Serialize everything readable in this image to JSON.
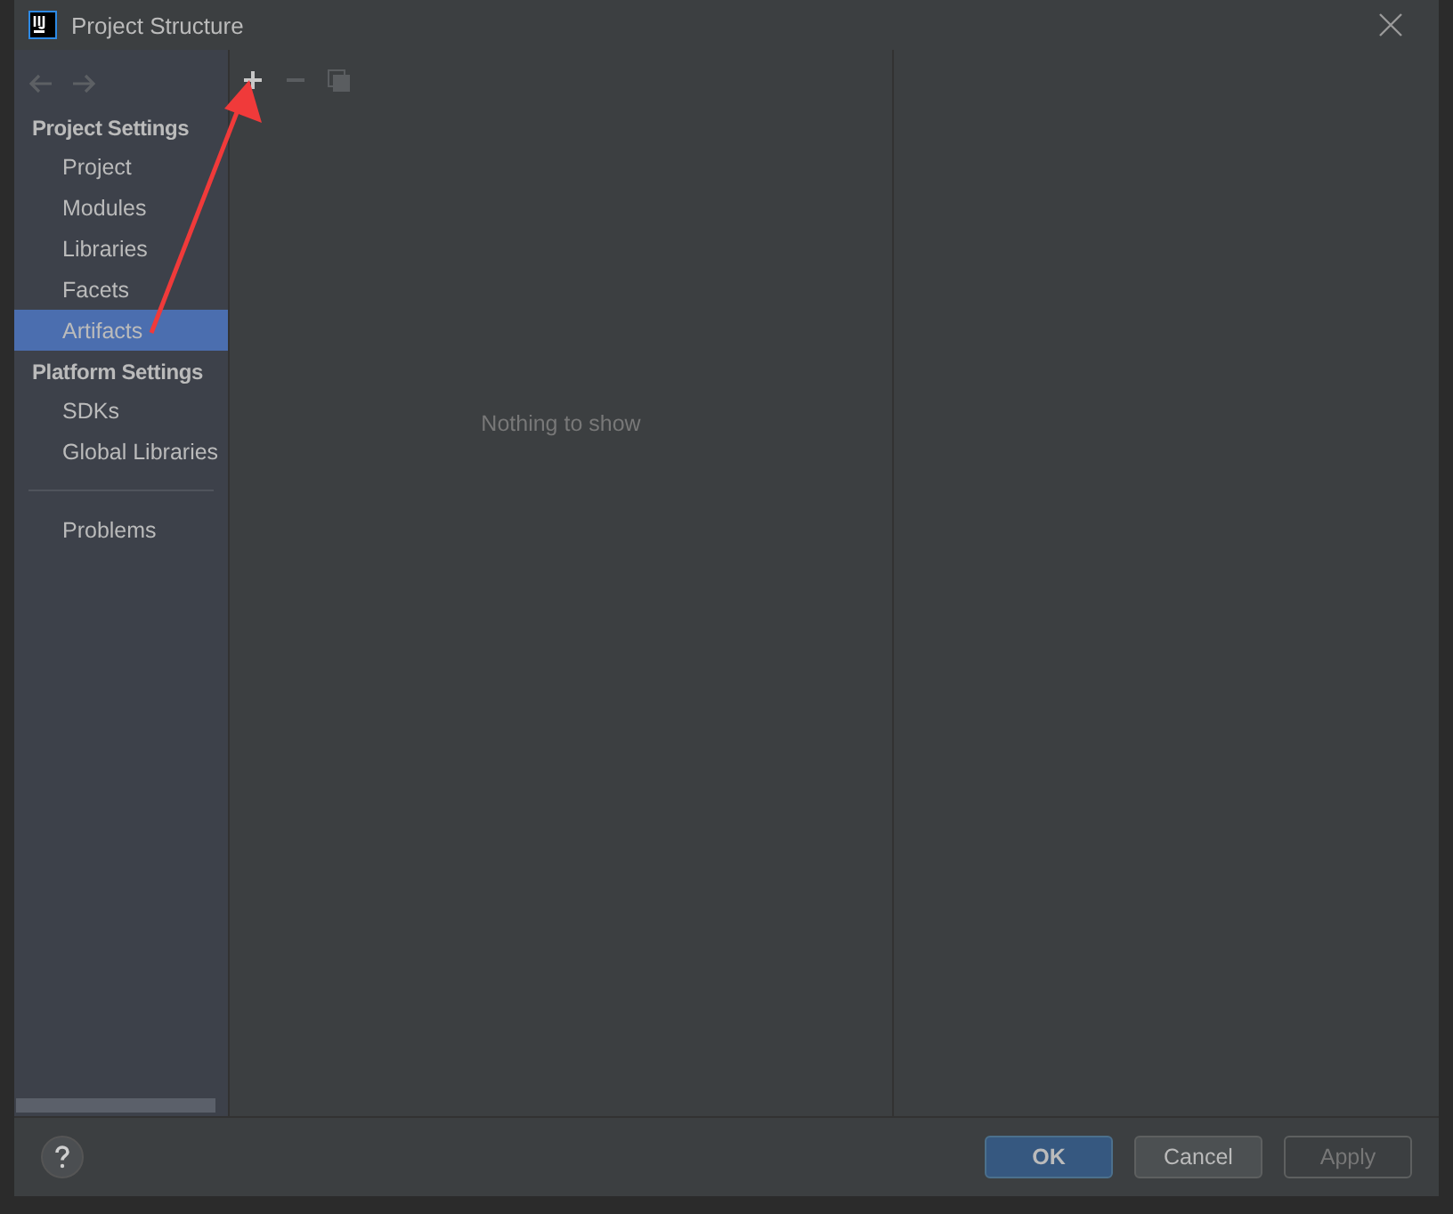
{
  "window": {
    "title": "Project Structure"
  },
  "sidebar": {
    "sections": [
      {
        "title": "Project Settings",
        "items": [
          {
            "label": "Project",
            "selected": false
          },
          {
            "label": "Modules",
            "selected": false
          },
          {
            "label": "Libraries",
            "selected": false
          },
          {
            "label": "Facets",
            "selected": false
          },
          {
            "label": "Artifacts",
            "selected": true
          }
        ]
      },
      {
        "title": "Platform Settings",
        "items": [
          {
            "label": "SDKs",
            "selected": false
          },
          {
            "label": "Global Libraries",
            "selected": false
          }
        ]
      }
    ],
    "footer_items": [
      {
        "label": "Problems",
        "selected": false
      }
    ]
  },
  "list_panel": {
    "toolbar": [
      {
        "kind": "add",
        "disabled": false
      },
      {
        "kind": "remove",
        "disabled": true
      },
      {
        "kind": "copy",
        "disabled": true
      }
    ],
    "empty_text": "Nothing to show"
  },
  "buttons": [
    {
      "label": "OK",
      "kind": "primary",
      "disabled": false
    },
    {
      "label": "Cancel",
      "kind": "normal",
      "disabled": false
    },
    {
      "label": "Apply",
      "kind": "normal",
      "disabled": true
    }
  ]
}
